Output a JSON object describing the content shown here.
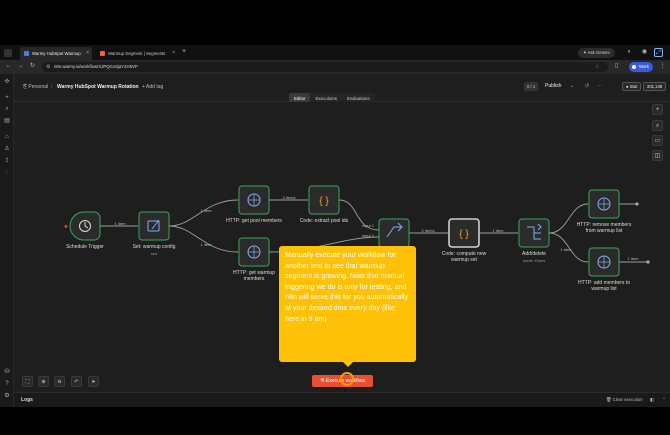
{
  "browser": {
    "tabs": [
      {
        "label": "Warmy HubSpot Warmup",
        "active": true
      },
      {
        "label": "Warmup Segment | Segments",
        "active": false
      }
    ],
    "gemini_label": "Ask Gemini",
    "url": "n8n.warmy.io/workflow/XJPQGxSjaY2H5VP",
    "profile_label": "Work"
  },
  "header": {
    "project": "Personal",
    "workflow_name": "Warmy HubSpot Warmup Rotation",
    "add_tag": "+ Add tag",
    "version_badge": "0 / 1",
    "publish_label": "Publish",
    "star_label": "Star",
    "star_count": "201,138"
  },
  "mode_tabs": [
    "Editor",
    "Executions",
    "Evaluations"
  ],
  "active_mode": "Editor",
  "nodes": [
    {
      "id": "schedule",
      "label": "Schedule Trigger",
      "sub": "",
      "icon": "clock-icon"
    },
    {
      "id": "set",
      "label": "Set: warmup config",
      "sub": "raw",
      "icon": "edit-icon"
    },
    {
      "id": "http_pool",
      "label": "HTTP: get pool members",
      "sub": "",
      "icon": "globe-icon"
    },
    {
      "id": "http_warmup",
      "label": "HTTP: get warmup",
      "label2": "members",
      "sub": "",
      "icon": "globe-icon"
    },
    {
      "id": "code_extract",
      "label": "Code: extract pool ids",
      "sub": "",
      "icon": "code-icon"
    },
    {
      "id": "merge",
      "label": "",
      "sub": "",
      "icon": "merge-icon"
    },
    {
      "id": "code_compute",
      "label": "Code: compute new",
      "label2": "warmup set",
      "sub": "",
      "icon": "code-icon"
    },
    {
      "id": "switch",
      "label": "Add/delete",
      "sub": "mode: Rules",
      "icon": "switch-icon"
    },
    {
      "id": "http_remove",
      "label": "HTTP: remove members",
      "label2": "from warmup list",
      "sub": "",
      "icon": "globe-icon"
    },
    {
      "id": "http_add",
      "label": "HTTP: add members to",
      "label2": "warmup list",
      "sub": "",
      "icon": "globe-icon"
    }
  ],
  "edges": [
    {
      "label": "1 item"
    },
    {
      "label": "1 item"
    },
    {
      "label": "1 item"
    },
    {
      "label": "3 items"
    },
    {
      "label": "input 1"
    },
    {
      "label": "input 2"
    },
    {
      "label": "2 items"
    },
    {
      "label": "1 item"
    },
    {
      "label": "1 item"
    },
    {
      "label": "1 item"
    }
  ],
  "tooltip_text": "Manually execute your workflow for another test to see that warmup segment is growing. Note that manual triggering we do is only for testing, and n8n will serve this for you automatically at your desired time every day (like here in 9 am)",
  "execute_button": "Execute workflow",
  "logs": {
    "label": "Logs",
    "clear_label": "Clear execution"
  },
  "colors": {
    "accent": "#e8502f",
    "tooltip": "#ffc107",
    "node_border": "#3aa55d",
    "node_bg": "#2b2b2b"
  }
}
